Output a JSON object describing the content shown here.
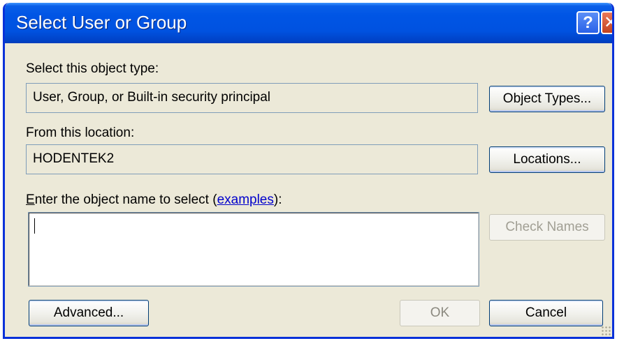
{
  "window": {
    "title": "Select User or Group",
    "help_glyph": "?",
    "close_glyph": "✕"
  },
  "object_type": {
    "label": "Select this object type:",
    "value": "User, Group, or Built-in security principal",
    "button_label": "Object Types..."
  },
  "location": {
    "label": "From this location:",
    "value": "HODENTEK2",
    "button_label": "Locations..."
  },
  "object_name": {
    "label_prefix_mnemonic": "E",
    "label_prefix_rest": "nter the object name to select (",
    "label_link": "examples",
    "label_suffix": "):",
    "value": "",
    "check_names_label": "Check Names"
  },
  "footer": {
    "advanced_label": "Advanced...",
    "ok_label": "OK",
    "cancel_label": "Cancel"
  },
  "colors": {
    "titlebar": "#0055e5",
    "dialog_bg": "#ece9d8",
    "close_button": "#c3431f",
    "link": "#0000cc"
  },
  "icons": [
    "help-icon",
    "close-icon",
    "resize-grip-icon"
  ]
}
